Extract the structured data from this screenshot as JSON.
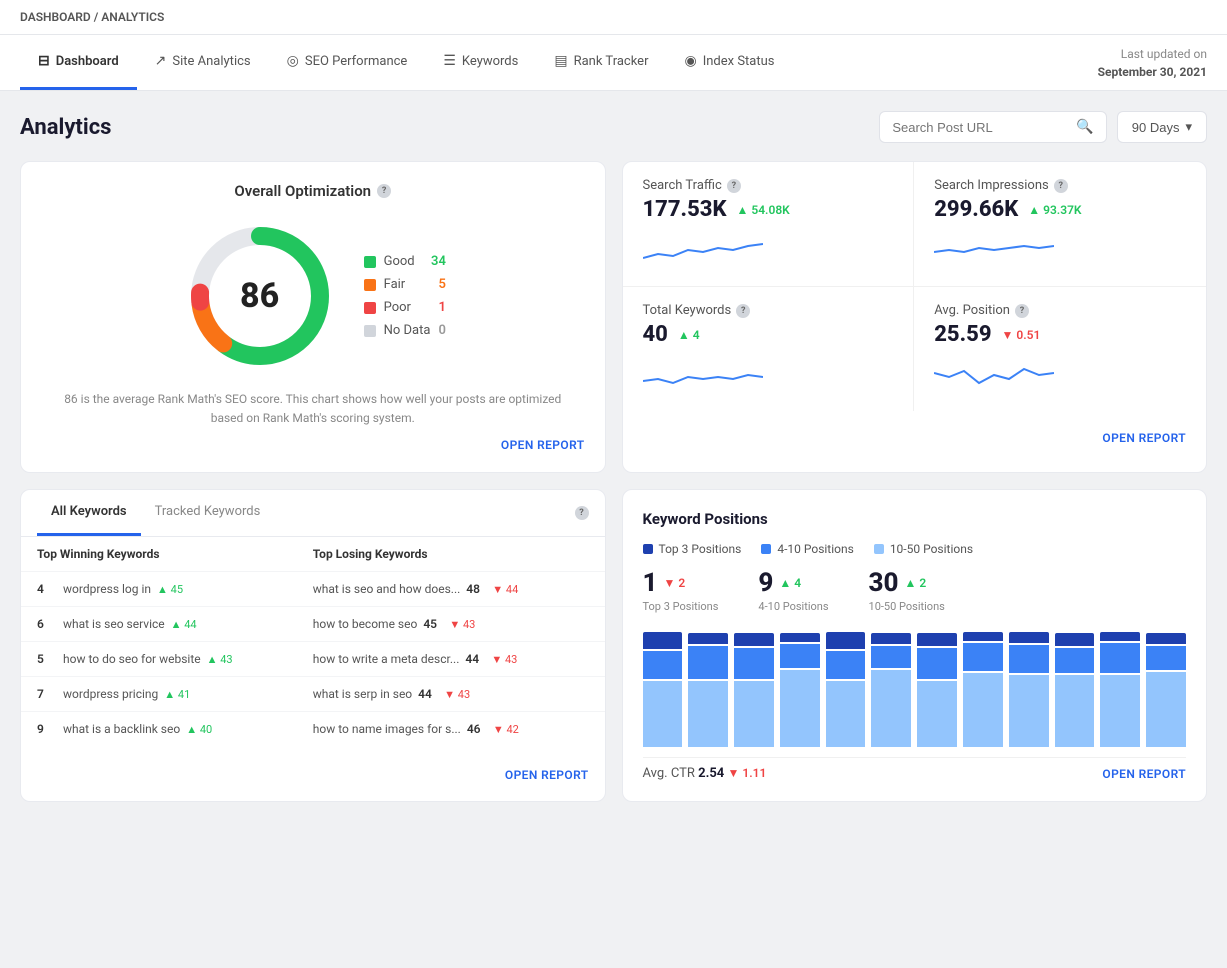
{
  "breadcrumb": {
    "base": "DASHBOARD",
    "separator": "/",
    "current": "ANALYTICS"
  },
  "nav": {
    "tabs": [
      {
        "id": "dashboard",
        "label": "Dashboard",
        "icon": "⊟",
        "active": true
      },
      {
        "id": "site-analytics",
        "label": "Site Analytics",
        "icon": "↗",
        "active": false
      },
      {
        "id": "seo-performance",
        "label": "SEO Performance",
        "icon": "◎",
        "active": false
      },
      {
        "id": "keywords",
        "label": "Keywords",
        "icon": "☰",
        "active": false
      },
      {
        "id": "rank-tracker",
        "label": "Rank Tracker",
        "icon": "▤",
        "active": false
      },
      {
        "id": "index-status",
        "label": "Index Status",
        "icon": "◉",
        "active": false
      }
    ],
    "last_updated_label": "Last updated on",
    "last_updated_date": "September 30, 2021"
  },
  "page": {
    "title": "Analytics",
    "search_placeholder": "Search Post URL",
    "dropdown_label": "90 Days"
  },
  "optimization": {
    "title": "Overall Optimization",
    "score": "86",
    "desc": "86 is the average Rank Math's SEO score. This chart shows how well your posts are optimized based on Rank Math's scoring system.",
    "legend": [
      {
        "label": "Good",
        "value": "34",
        "color": "#22c55e",
        "cls": "good"
      },
      {
        "label": "Fair",
        "value": "5",
        "color": "#f97316",
        "cls": "fair"
      },
      {
        "label": "Poor",
        "value": "1",
        "color": "#ef4444",
        "cls": "poor"
      },
      {
        "label": "No Data",
        "value": "0",
        "color": "#d1d5db",
        "cls": "nodata"
      }
    ],
    "open_report": "OPEN REPORT"
  },
  "stats": {
    "open_report": "OPEN REPORT",
    "items": [
      {
        "label": "Search Traffic",
        "value": "177.53K",
        "change": "54.08K",
        "dir": "up"
      },
      {
        "label": "Search Impressions",
        "value": "299.66K",
        "change": "93.37K",
        "dir": "up"
      },
      {
        "label": "Total Keywords",
        "value": "40",
        "change": "4",
        "dir": "up"
      },
      {
        "label": "Avg. Position",
        "value": "25.59",
        "change": "0.51",
        "dir": "down"
      }
    ]
  },
  "keywords": {
    "tabs": [
      "All Keywords",
      "Tracked Keywords"
    ],
    "active_tab": 0,
    "col1_header": "Top Winning Keywords",
    "col2_header": "Top Losing Keywords",
    "rows": [
      {
        "w_kw": "wordpress log in",
        "w_pos": "4",
        "w_chg": "45",
        "l_kw": "what is seo and how does...",
        "l_pos": "48",
        "l_chg": "44"
      },
      {
        "w_kw": "what is seo service",
        "w_pos": "6",
        "w_chg": "44",
        "l_kw": "how to become seo",
        "l_pos": "45",
        "l_chg": "43"
      },
      {
        "w_kw": "how to do seo for website",
        "w_pos": "5",
        "w_chg": "43",
        "l_kw": "how to write a meta descr...",
        "l_pos": "44",
        "l_chg": "43"
      },
      {
        "w_kw": "wordpress pricing",
        "w_pos": "7",
        "w_chg": "41",
        "l_kw": "what is serp in seo",
        "l_pos": "44",
        "l_chg": "43"
      },
      {
        "w_kw": "what is a backlink seo",
        "w_pos": "9",
        "w_chg": "40",
        "l_kw": "how to name images for s...",
        "l_pos": "46",
        "l_chg": "42"
      }
    ],
    "open_report": "OPEN REPORT"
  },
  "keyword_positions": {
    "title": "Keyword Positions",
    "legend": [
      {
        "label": "Top 3 Positions",
        "color": "#1e40af"
      },
      {
        "label": "4-10 Positions",
        "color": "#3b82f6"
      },
      {
        "label": "10-50 Positions",
        "color": "#93c5fd"
      }
    ],
    "stats": [
      {
        "label": "Top 3 Positions",
        "value": "1",
        "change": "2",
        "dir": "down"
      },
      {
        "label": "4-10 Positions",
        "value": "9",
        "change": "4",
        "dir": "up"
      },
      {
        "label": "10-50 Positions",
        "value": "30",
        "change": "2",
        "dir": "up"
      }
    ],
    "bars": [
      {
        "top3": 15,
        "mid": 25,
        "low": 60
      },
      {
        "top3": 10,
        "mid": 30,
        "low": 60
      },
      {
        "top3": 12,
        "mid": 28,
        "low": 60
      },
      {
        "top3": 8,
        "mid": 22,
        "low": 70
      },
      {
        "top3": 15,
        "mid": 25,
        "low": 60
      },
      {
        "top3": 10,
        "mid": 20,
        "low": 70
      },
      {
        "top3": 12,
        "mid": 28,
        "low": 60
      },
      {
        "top3": 8,
        "mid": 25,
        "low": 67
      },
      {
        "top3": 10,
        "mid": 25,
        "low": 65
      },
      {
        "top3": 12,
        "mid": 23,
        "low": 65
      },
      {
        "top3": 8,
        "mid": 27,
        "low": 65
      },
      {
        "top3": 10,
        "mid": 22,
        "low": 68
      }
    ],
    "avg_ctr_label": "Avg. CTR",
    "avg_ctr_value": "2.54",
    "avg_ctr_change": "1.11",
    "avg_ctr_dir": "down",
    "open_report": "OPEN REPORT"
  }
}
